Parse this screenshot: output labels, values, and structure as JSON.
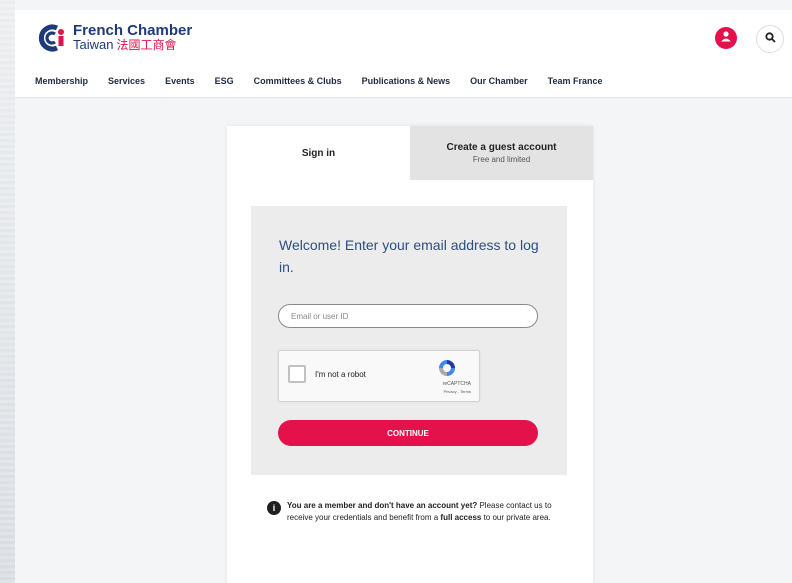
{
  "header": {
    "logo": {
      "line1": "French Chamber",
      "line2": "Taiwan",
      "line2_zh": "法國工商會",
      "icon": "cci-logo-icon"
    },
    "user_icon": "user-icon",
    "search_icon": "search-icon"
  },
  "nav": {
    "items": [
      {
        "label": "Membership"
      },
      {
        "label": "Services"
      },
      {
        "label": "Events"
      },
      {
        "label": "ESG"
      },
      {
        "label": "Committees & Clubs"
      },
      {
        "label": "Publications & News"
      },
      {
        "label": "Our Chamber"
      },
      {
        "label": "Team France"
      }
    ]
  },
  "login": {
    "tabs": {
      "signin": "Sign in",
      "guest_title": "Create a guest account",
      "guest_subtitle": "Free and limited"
    },
    "welcome": "Welcome! Enter your email address to log in.",
    "email_placeholder": "Email or user ID",
    "recaptcha": {
      "label": "I'm not a robot",
      "brand": "reCAPTCHA",
      "terms": "Privacy - Terms"
    },
    "continue_label": "CONTINUE",
    "info": {
      "bold1": "You are a member and don't have an account yet?",
      "text1": " Please contact us to receive your credentials and benefit from a ",
      "bold2": "full access",
      "text2": " to our private area."
    }
  },
  "colors": {
    "brand_red": "#e3124b",
    "brand_blue": "#1e3a78",
    "welcome_blue": "#2d4f7e"
  }
}
